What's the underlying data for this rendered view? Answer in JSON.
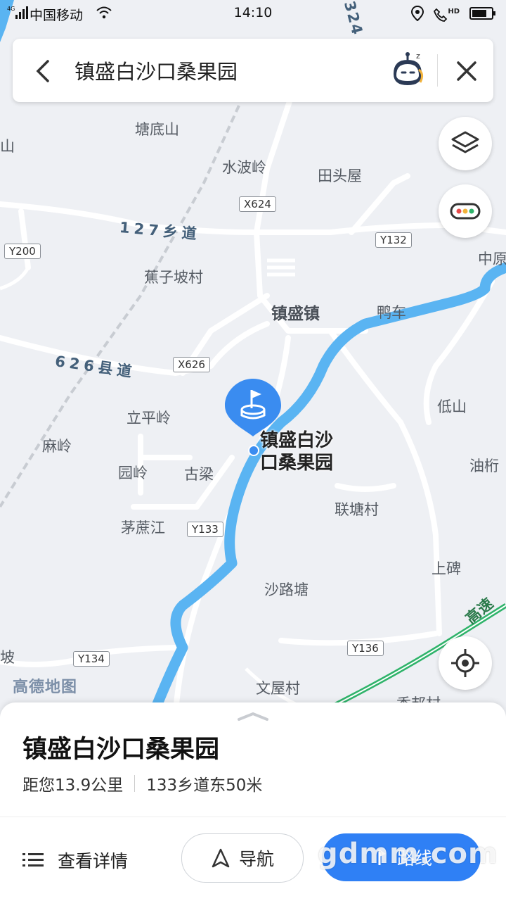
{
  "status": {
    "network": "4G",
    "carrier": "中国移动",
    "time": "14:10",
    "hd": "HD"
  },
  "search": {
    "query": "镇盛白沙口桑果园"
  },
  "map": {
    "labels": {
      "tangdishan": "塘底山",
      "shuiboling": "水波岭",
      "tiantouwu": "田头屋",
      "jiaozipo": "蕉子坡村",
      "zhenshengzhen": "镇盛镇",
      "yache": "鸭车",
      "zhongyuan": "中原",
      "lipingling": "立平岭",
      "maling": "麻岭",
      "yuanling": "园岭",
      "guliang": "古梁",
      "maozhejiang": "茅蔗江",
      "dishan": "低山",
      "youhang": "油桁",
      "liantangcun": "联塘村",
      "shangbei": "上碑",
      "shalutang": "沙路塘",
      "wenwucun": "文屋村",
      "xiangbangcun": "香邦村",
      "gaosu": "高速",
      "bo": "坡",
      "shan_left": "山"
    },
    "roads": {
      "r127": "127乡道",
      "r626": "626县道",
      "r324": "324"
    },
    "badges": {
      "x624": "X624",
      "y132": "Y132",
      "y200": "Y200",
      "x626": "X626",
      "y133": "Y133",
      "y136": "Y136",
      "y134": "Y134"
    },
    "logo": "高德地图",
    "pin_label": "镇盛白沙口桑果园",
    "colors": {
      "river": "#5ab4f2",
      "highway": "#2fb36a",
      "pin": "#3a8cf0"
    }
  },
  "place": {
    "name": "镇盛白沙口桑果园",
    "distance": "距您13.9公里",
    "address": "133乡道东50米"
  },
  "actions": {
    "details": "查看详情",
    "navigate": "导航",
    "route": "路线"
  },
  "watermark": "gdmm.com"
}
